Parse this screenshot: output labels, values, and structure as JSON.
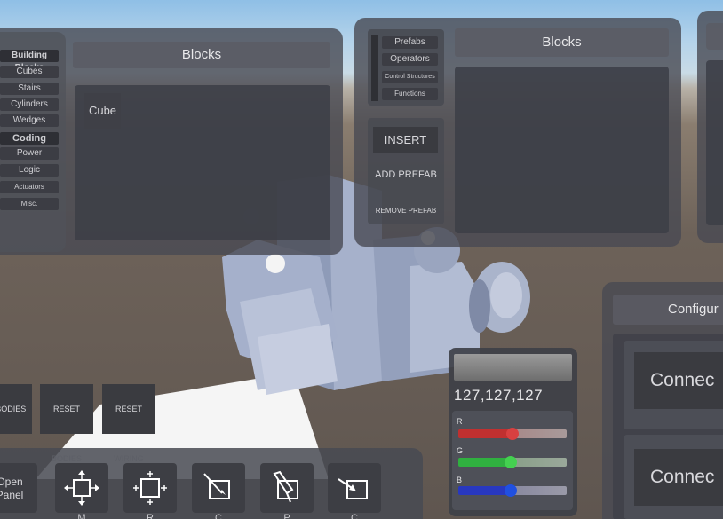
{
  "left_panel": {
    "categories": [
      {
        "label": "Building Blocks",
        "header": true
      },
      {
        "label": "Cubes"
      },
      {
        "label": "Stairs"
      },
      {
        "label": "Cylinders"
      },
      {
        "label": "Wedges"
      },
      {
        "label": "Coding",
        "header": true
      },
      {
        "label": "Power"
      },
      {
        "label": "Logic"
      },
      {
        "label": "Actuators"
      },
      {
        "label": "Misc."
      }
    ],
    "title": "Blocks",
    "items": [
      "Cube"
    ]
  },
  "right_panel": {
    "tabs": [
      "Prefabs",
      "Operators",
      "Control Structures",
      "Functions"
    ],
    "title": "Blocks",
    "insert_label": "INSERT",
    "add_prefab_label": "ADD PREFAB",
    "remove_prefab_label": "REMOVE PREFAB"
  },
  "config_panel": {
    "title": "Configur",
    "connect_1": "Connec",
    "connect_2": "Connec"
  },
  "reset_buttons": {
    "bodies_partial": "E BODIES",
    "reset_bodies": "RESET BODIES",
    "reset_wiring": "RESET WIRING"
  },
  "color_panel": {
    "rgb_text": "127,127,127",
    "r_label": "R",
    "g_label": "G",
    "b_label": "B",
    "r": 127,
    "g": 127,
    "b": 127,
    "r_color": "#c03030",
    "g_color": "#30b040",
    "b_color": "#2838c0"
  },
  "toolbar": {
    "open_panel_line1": "Open",
    "open_panel_line2": "Panel",
    "tools": [
      {
        "icon": "move-icon",
        "label": "M"
      },
      {
        "icon": "resize-icon",
        "label": "R"
      },
      {
        "icon": "color-icon",
        "label": "C"
      },
      {
        "icon": "paint-icon",
        "label": "P"
      },
      {
        "icon": "config-icon",
        "label": "C"
      }
    ]
  }
}
